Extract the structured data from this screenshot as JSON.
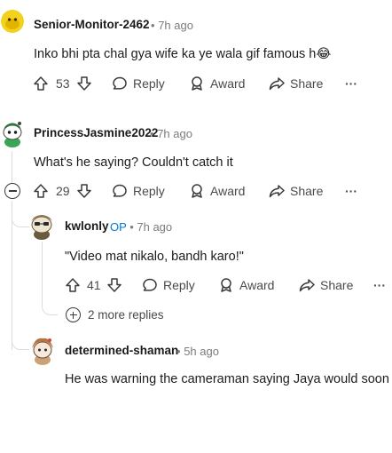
{
  "comments": [
    {
      "username": "Senior-Monitor-2462",
      "separator": "•",
      "time": "7h ago",
      "body": "Inko bhi pta chal gya wife ka ye wala gif famous h😂",
      "votes": "53",
      "reply_label": "Reply",
      "award_label": "Award",
      "share_label": "Share",
      "more_label": "···"
    },
    {
      "username": "PrincessJasmine2022",
      "separator": "•",
      "time": "7h ago",
      "body": "What's he saying? Couldn't catch it",
      "votes": "29",
      "reply_label": "Reply",
      "award_label": "Award",
      "share_label": "Share",
      "more_label": "···"
    },
    {
      "username": "kwlonly",
      "op_badge": "OP",
      "separator": "•",
      "time": "7h ago",
      "body": "\"Video mat nikalo, bandh karo!\"",
      "votes": "41",
      "reply_label": "Reply",
      "award_label": "Award",
      "share_label": "Share",
      "more_label": "···"
    },
    {
      "username": "determined-shaman",
      "separator": "•",
      "time": "5h ago",
      "body": "He was warning the cameraman saying Jaya would soon"
    }
  ],
  "more_replies_label": "2 more replies",
  "colors": {
    "text": "#1c1c1c",
    "muted": "#7c7c7c",
    "op_blue": "#0079d3",
    "thread_line": "#dcdcdc"
  }
}
